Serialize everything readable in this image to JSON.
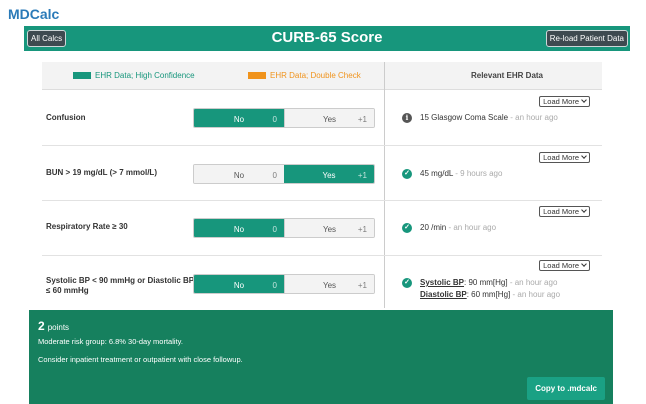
{
  "app": {
    "name": "MDCalc"
  },
  "header": {
    "title": "CURB-65 Score",
    "all_calcs": "All Calcs",
    "reload": "Re-load Patient Data"
  },
  "legend": {
    "high": "EHR Data; High Confidence",
    "double": "EHR Data; Double Check",
    "relevant": "Relevant EHR Data"
  },
  "colors": {
    "primary": "#17967c",
    "warning": "#f0931c",
    "result_bg": "#16805e"
  },
  "rows": [
    {
      "label": "Confusion",
      "no_label": "No",
      "no_pts": "0",
      "yes_label": "Yes",
      "yes_pts": "+1",
      "selected": "no",
      "load_more": "Load More",
      "ehr_icon": "info-icon",
      "ehr_value": "15 Glasgow Coma Scale",
      "ehr_ago": " - an hour ago"
    },
    {
      "label": "BUN > 19 mg/dL (> 7 mmol/L)",
      "no_label": "No",
      "no_pts": "0",
      "yes_label": "Yes",
      "yes_pts": "+1",
      "selected": "yes",
      "load_more": "Load More",
      "ehr_icon": "check-icon",
      "ehr_value": "45 mg/dL",
      "ehr_ago": " - 9 hours ago"
    },
    {
      "label": "Respiratory Rate ≥ 30",
      "no_label": "No",
      "no_pts": "0",
      "yes_label": "Yes",
      "yes_pts": "+1",
      "selected": "no",
      "load_more": "Load More",
      "ehr_icon": "check-icon",
      "ehr_value": "20 /min",
      "ehr_ago": " - an hour ago"
    },
    {
      "label": "Systolic BP < 90 mmHg or Diastolic BP ≤ 60 mmHg",
      "no_label": "No",
      "no_pts": "0",
      "yes_label": "Yes",
      "yes_pts": "+1",
      "selected": "no",
      "load_more": "Load More",
      "ehr_icon": "check-icon",
      "ehr_sys_label": "Systolic BP",
      "ehr_sys_value": ": 90 mm[Hg]",
      "ehr_sys_ago": " - an hour ago",
      "ehr_dia_label": "Diastolic BP",
      "ehr_dia_value": ": 60 mm[Hg]",
      "ehr_dia_ago": " - an hour ago"
    }
  ],
  "result": {
    "points": "2",
    "points_label": "points",
    "risk": "Moderate risk group: 6.8% 30-day mortality.",
    "advice": "Consider inpatient treatment or outpatient with close followup.",
    "copy": "Copy to .mdcalc"
  }
}
